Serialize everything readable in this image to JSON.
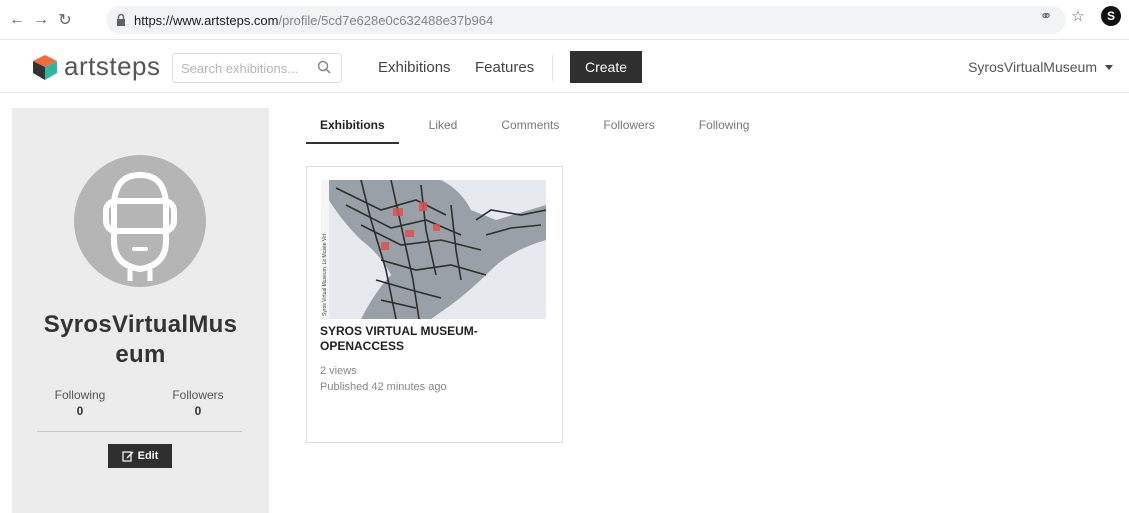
{
  "browser": {
    "url_scheme": "https://www.artsteps.com",
    "url_path": "/profile/5cd7e628e0c632488e37b964",
    "profile_initial": "S"
  },
  "header": {
    "logo_text": "artsteps",
    "search_placeholder": "Search exhibitions...",
    "menu": {
      "exhibitions": "Exhibitions",
      "features": "Features",
      "create": "Create"
    },
    "user_name": "SyrosVirtualMuseum"
  },
  "profile": {
    "name": "SyrosVirtualMuseum",
    "following_label": "Following",
    "following_count": "0",
    "followers_label": "Followers",
    "followers_count": "0",
    "edit_label": "Edit"
  },
  "tabs": [
    {
      "label": "Exhibitions",
      "active": true
    },
    {
      "label": "Liked",
      "active": false
    },
    {
      "label": "Comments",
      "active": false
    },
    {
      "label": "Followers",
      "active": false
    },
    {
      "label": "Following",
      "active": false
    }
  ],
  "exhibition": {
    "title": "SYROS VIRTUAL MUSEUM-OPENACCESS",
    "views": "2 views",
    "published": "Published 42 minutes ago",
    "thumb_caption": "Syros Virtual Museum, Le Musée Virt"
  },
  "colors": {
    "logo_orange": "#f26b3a",
    "logo_teal": "#2fb5a0",
    "logo_dark": "#333333",
    "button_dark": "#2f2f2f",
    "sidebar_bg": "#ececec",
    "avatar_bg": "#b5b5b5"
  }
}
